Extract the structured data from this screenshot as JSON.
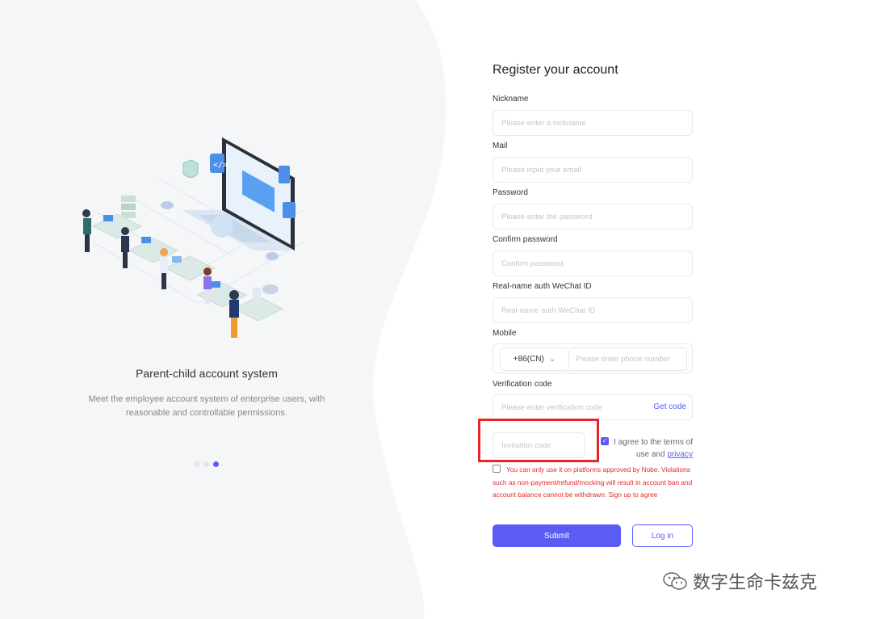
{
  "colors": {
    "accent": "#5b5cf6",
    "error": "#e8262a",
    "left_bg": "#f5f6f8"
  },
  "left": {
    "title": "Parent-child account system",
    "description": "Meet the employee account system of enterprise users, with reasonable and controllable permissions.",
    "carousel_dots": 3,
    "active_dot": 2
  },
  "form": {
    "title": "Register your account",
    "fields": {
      "nickname": {
        "label": "Nickname",
        "placeholder": "Please enter a nickname"
      },
      "mail": {
        "label": "Mail",
        "placeholder": "Please input your email"
      },
      "password": {
        "label": "Password",
        "placeholder": "Please enter the password"
      },
      "confirm_password": {
        "label": "Confirm password",
        "placeholder": "Confirm password"
      },
      "wechat": {
        "label": "Real-name auth WeChat ID",
        "placeholder": "Real-name auth WeChat ID"
      },
      "mobile": {
        "label": "Mobile",
        "country_code": "+86(CN)",
        "placeholder": "Please enter phone number"
      },
      "verification": {
        "label": "Verification code",
        "placeholder": "Please enter verification code",
        "get_code": "Get code"
      },
      "invitation": {
        "placeholder": "Invitation code"
      }
    },
    "agree_text": "I agree to the terms of use and",
    "agree_link": "privacy",
    "agree_checked": true,
    "warning": "You can only use it on platforms approved by Nobe. Violations such as non-payment/refund/mocking will result in account ban and account balance cannot be withdrawn. Sign up to agree",
    "warning_checked": false,
    "submit": "Submit",
    "login": "Log in"
  },
  "watermark": {
    "text": "数字生命卡兹克",
    "icon": "wechat-icon"
  }
}
